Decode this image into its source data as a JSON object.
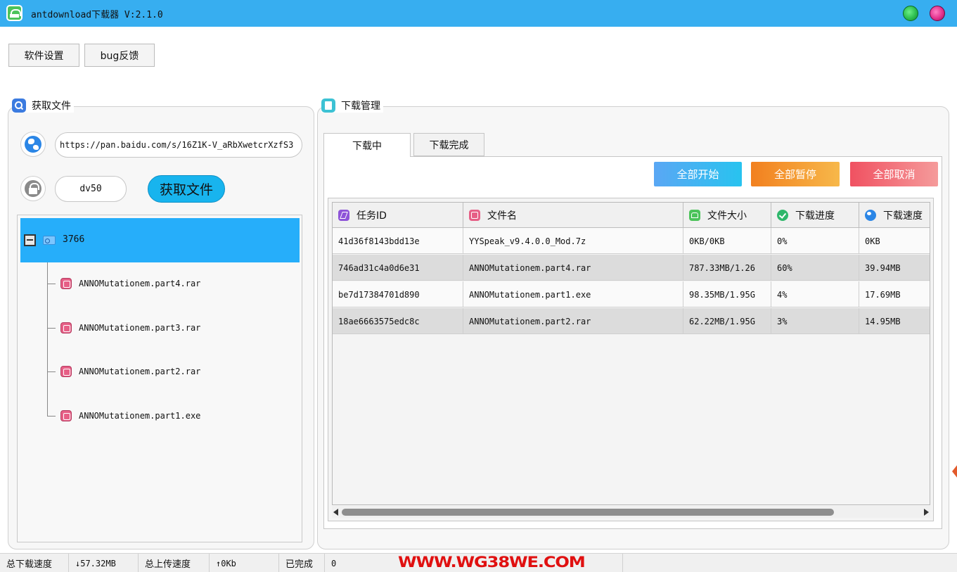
{
  "titlebar": {
    "title": "antdownload下载器  V:2.1.0",
    "app_icon": "android-icon",
    "control_colors": [
      "#2cbd4f",
      "#e2318d"
    ]
  },
  "toolbar": {
    "settings_label": "软件设置",
    "feedback_label": "bug反馈"
  },
  "left_panel": {
    "title": "获取文件",
    "url_value": "https://pan.baidu.com/s/16Z1K-V_aRbXwetcrXzfS3",
    "password_value": "dv50",
    "fetch_label": "获取文件",
    "tree": {
      "root_label": "3766",
      "items": [
        "ANNOMutationem.part4.rar",
        "ANNOMutationem.part3.rar",
        "ANNOMutationem.part2.rar",
        "ANNOMutationem.part1.exe"
      ]
    }
  },
  "right_panel": {
    "title": "下载管理",
    "tabs": [
      "下载中",
      "下载完成"
    ],
    "active_tab": 0,
    "buttons": {
      "start_all": "全部开始",
      "pause_all": "全部暂停",
      "cancel_all": "全部取消"
    },
    "table": {
      "headers": [
        "任务ID",
        "文件名",
        "文件大小",
        "下载进度",
        "下载速度"
      ],
      "rows": [
        [
          "41d36f8143bdd13e",
          "YYSpeak_v9.4.0.0_Mod.7z",
          "0KB/0KB",
          "0%",
          "0KB"
        ],
        [
          "746ad31c4a0d6e31",
          "ANNOMutationem.part4.rar",
          "787.33MB/1.26",
          "60%",
          "39.94MB"
        ],
        [
          "be7d17384701d890",
          "ANNOMutationem.part1.exe",
          "98.35MB/1.95G",
          "4%",
          "17.69MB"
        ],
        [
          "18ae6663575edc8c",
          "ANNOMutationem.part2.rar",
          "62.22MB/1.95G",
          "3%",
          "14.95MB"
        ]
      ]
    }
  },
  "statusbar": {
    "download_speed_label": "总下载速度",
    "download_speed_value": "↓57.32MB",
    "upload_speed_label": "总上传速度",
    "upload_speed_value": "↑0Kb",
    "completed_label": "已完成",
    "completed_value": "0",
    "watermark": "WWW.WG38WE.COM"
  },
  "colors": {
    "titlebar": "#37aef0",
    "selection": "#26aefa",
    "fetch_button": "#18b4ee"
  }
}
